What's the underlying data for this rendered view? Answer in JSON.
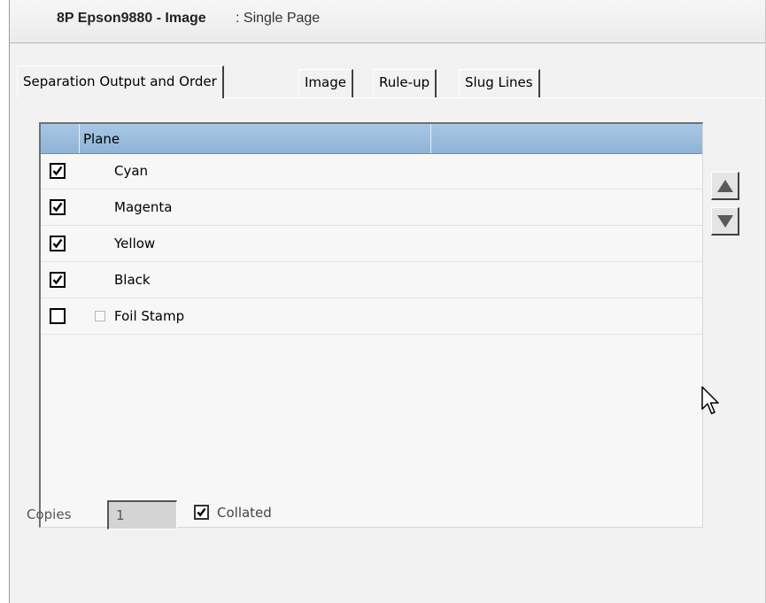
{
  "title": {
    "main": "8P Epson9880 - Image",
    "sub": ": Single Page"
  },
  "tabs": [
    {
      "label": "Separation Output and Order",
      "active": true
    },
    {
      "label": "Image",
      "active": false
    },
    {
      "label": "Rule-up",
      "active": false
    },
    {
      "label": "Slug Lines",
      "active": false
    }
  ],
  "grid": {
    "header": {
      "plane_label": "Plane"
    },
    "rows": [
      {
        "label": "Cyan",
        "checked": true
      },
      {
        "label": "Magenta",
        "checked": true
      },
      {
        "label": "Yellow",
        "checked": true
      },
      {
        "label": "Black",
        "checked": true
      },
      {
        "label": "Foil Stamp",
        "checked": false
      }
    ]
  },
  "copies": {
    "label": "Copies",
    "value": "1"
  },
  "collated": {
    "label": "Collated",
    "checked": true
  },
  "colors": {
    "header_blue": "#9fbfdf",
    "panel": "#f2f2f2",
    "arrow": "#5a5a5a"
  },
  "icons": {
    "move_up": "triangle-up-icon",
    "move_down": "triangle-down-icon",
    "cursor": "mouse-pointer-icon"
  }
}
